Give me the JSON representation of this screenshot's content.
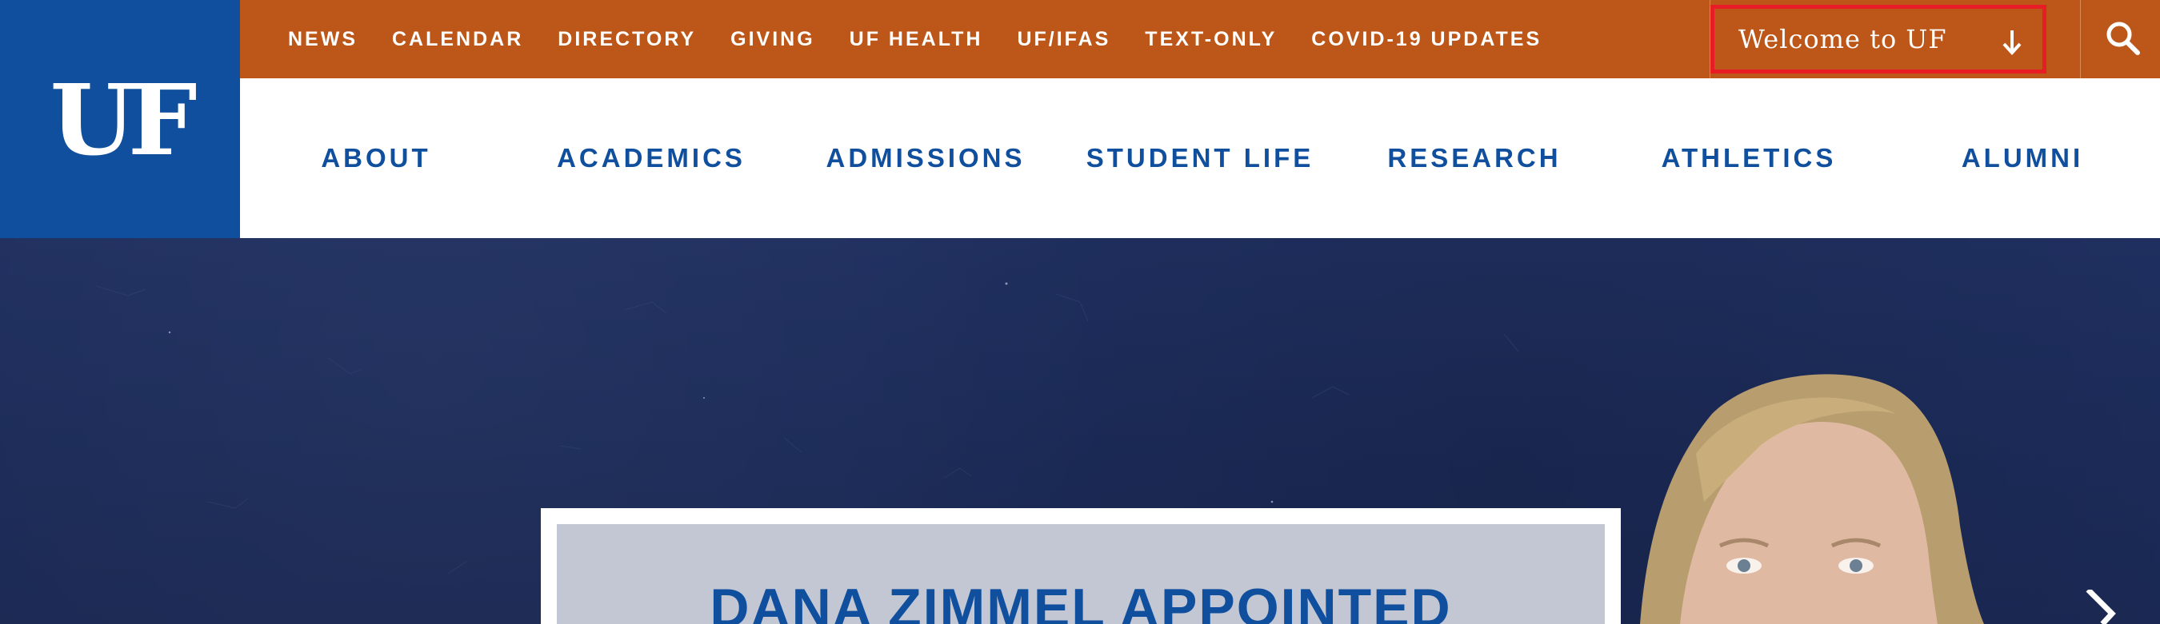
{
  "logo": {
    "text": "UF"
  },
  "utility_nav": {
    "links": [
      "NEWS",
      "CALENDAR",
      "DIRECTORY",
      "GIVING",
      "UF HEALTH",
      "UF/IFAS",
      "TEXT-ONLY",
      "COVID-19 UPDATES"
    ],
    "welcome_label": "Welcome to UF",
    "welcome_icon": "arrow-down-icon",
    "search_icon": "search-icon"
  },
  "main_nav": {
    "items": [
      "ABOUT",
      "ACADEMICS",
      "ADMISSIONS",
      "STUDENT LIFE",
      "RESEARCH",
      "ATHLETICS",
      "ALUMNI"
    ]
  },
  "hero": {
    "headline": "DANA ZIMMEL APPOINTED",
    "next_icon": "chevron-right-icon"
  },
  "colors": {
    "blue": "#0f4f9d",
    "orange": "#bd5719",
    "navy": "#1c2b58",
    "highlight": "#e81c24"
  }
}
